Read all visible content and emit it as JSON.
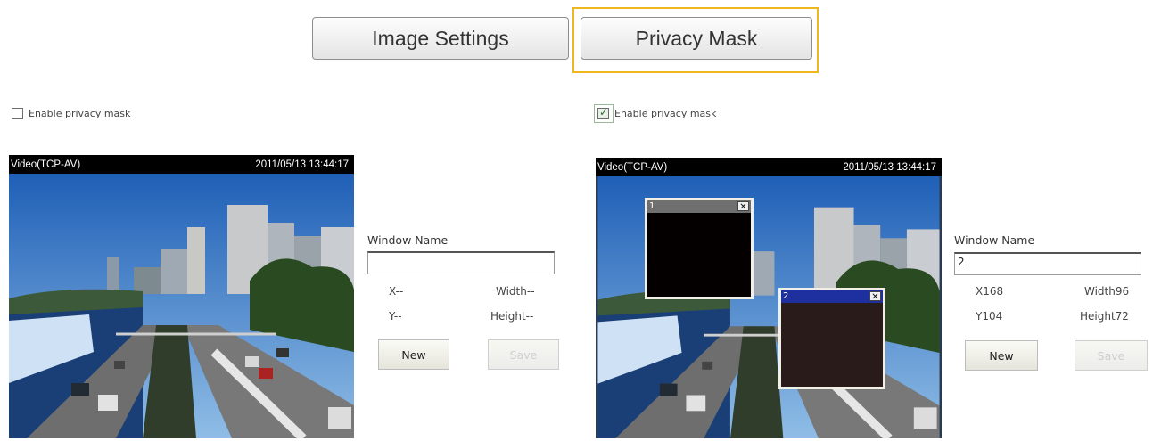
{
  "tabs": {
    "image_settings": "Image Settings",
    "privacy_mask": "Privacy Mask"
  },
  "left_panel": {
    "enable_label": "Enable privacy mask",
    "enabled": false,
    "video_title": "Video(TCP-AV)",
    "timestamp": "2011/05/13 13:44:17",
    "window_name_label": "Window Name",
    "window_name_value": "",
    "x_label": "X--",
    "y_label": "Y--",
    "width_label": "Width--",
    "height_label": "Height--",
    "new_button": "New",
    "save_button": "Save"
  },
  "right_panel": {
    "enable_label": "Enable privacy mask",
    "enabled": true,
    "video_title": "Video(TCP-AV)",
    "timestamp": "2011/05/13 13:44:17",
    "mask_1_label": "1",
    "mask_2_label": "2",
    "window_name_label": "Window Name",
    "window_name_value": "2",
    "x_label": "X168",
    "y_label": "Y104",
    "width_label": "Width96",
    "height_label": "Height72",
    "new_button": "New",
    "save_button": "Save"
  },
  "colors": {
    "active_tab_highlight": "#f0b71c",
    "active_mask_titlebar": "#1e2fa0"
  }
}
